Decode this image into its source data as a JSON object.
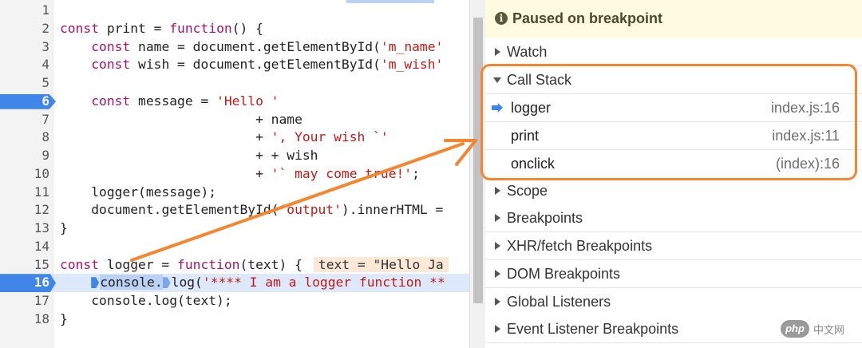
{
  "editor": {
    "lines": [
      {
        "n": "1"
      },
      {
        "n": "2"
      },
      {
        "n": "3"
      },
      {
        "n": "4"
      },
      {
        "n": "5"
      },
      {
        "n": "6",
        "breakpoint": true
      },
      {
        "n": "7"
      },
      {
        "n": "8"
      },
      {
        "n": "9"
      },
      {
        "n": "10"
      },
      {
        "n": "11"
      },
      {
        "n": "12"
      },
      {
        "n": "13"
      },
      {
        "n": "14"
      },
      {
        "n": "15"
      },
      {
        "n": "16",
        "current": true
      },
      {
        "n": "17"
      },
      {
        "n": "18"
      }
    ],
    "code": {
      "l2_kw": "const",
      "l2_a": " print = ",
      "l2_fn": "function",
      "l2_b": "() {",
      "l3_kw": "const",
      "l3_a": " name = document.getElementById(",
      "l3_st": "'m_name'",
      "l4_kw": "const",
      "l4_a": " wish = document.getElementById(",
      "l4_st": "'m_wish'",
      "l6_kw": "const",
      "l6_a": " message = ",
      "l6_st": "'Hello '",
      "l7": "+ name",
      "l8_a": "+ ",
      "l8_st": "', Your wish `'",
      "l9": "+ + wish",
      "l10_a": "+ ",
      "l10_st": "'` may come true!'",
      "l10_b": ";",
      "l11": "logger(message);",
      "l12_a": "document.getElementById(",
      "l12_st": "'output'",
      "l12_b": ").innerHTML =",
      "l13": "}",
      "l15_kw": "const",
      "l15_a": " logger = ",
      "l15_fn": "function",
      "l15_b": "(text) {",
      "l15_inline": "text = \"Hello Ja",
      "l16_a": "console.",
      "l16_b": "log(",
      "l16_st": "'**** I am a logger function **",
      "l17": "console.log(text);",
      "l18": "}"
    }
  },
  "debugger": {
    "banner": "Paused on breakpoint",
    "watch": "Watch",
    "call_stack": "Call Stack",
    "frames": [
      {
        "name": "logger",
        "loc": "index.js:16"
      },
      {
        "name": "print",
        "loc": "index.js:11"
      },
      {
        "name": "onclick",
        "loc": "(index):16"
      }
    ],
    "sections": [
      "Scope",
      "Breakpoints",
      "XHR/fetch Breakpoints",
      "DOM Breakpoints",
      "Global Listeners",
      "Event Listener Breakpoints"
    ]
  },
  "watermark": {
    "logo": "php",
    "text": "中文网"
  },
  "colors": {
    "accent": "#3f86e8",
    "annotation": "#f5852e",
    "banner_bg": "#fffbe2"
  }
}
